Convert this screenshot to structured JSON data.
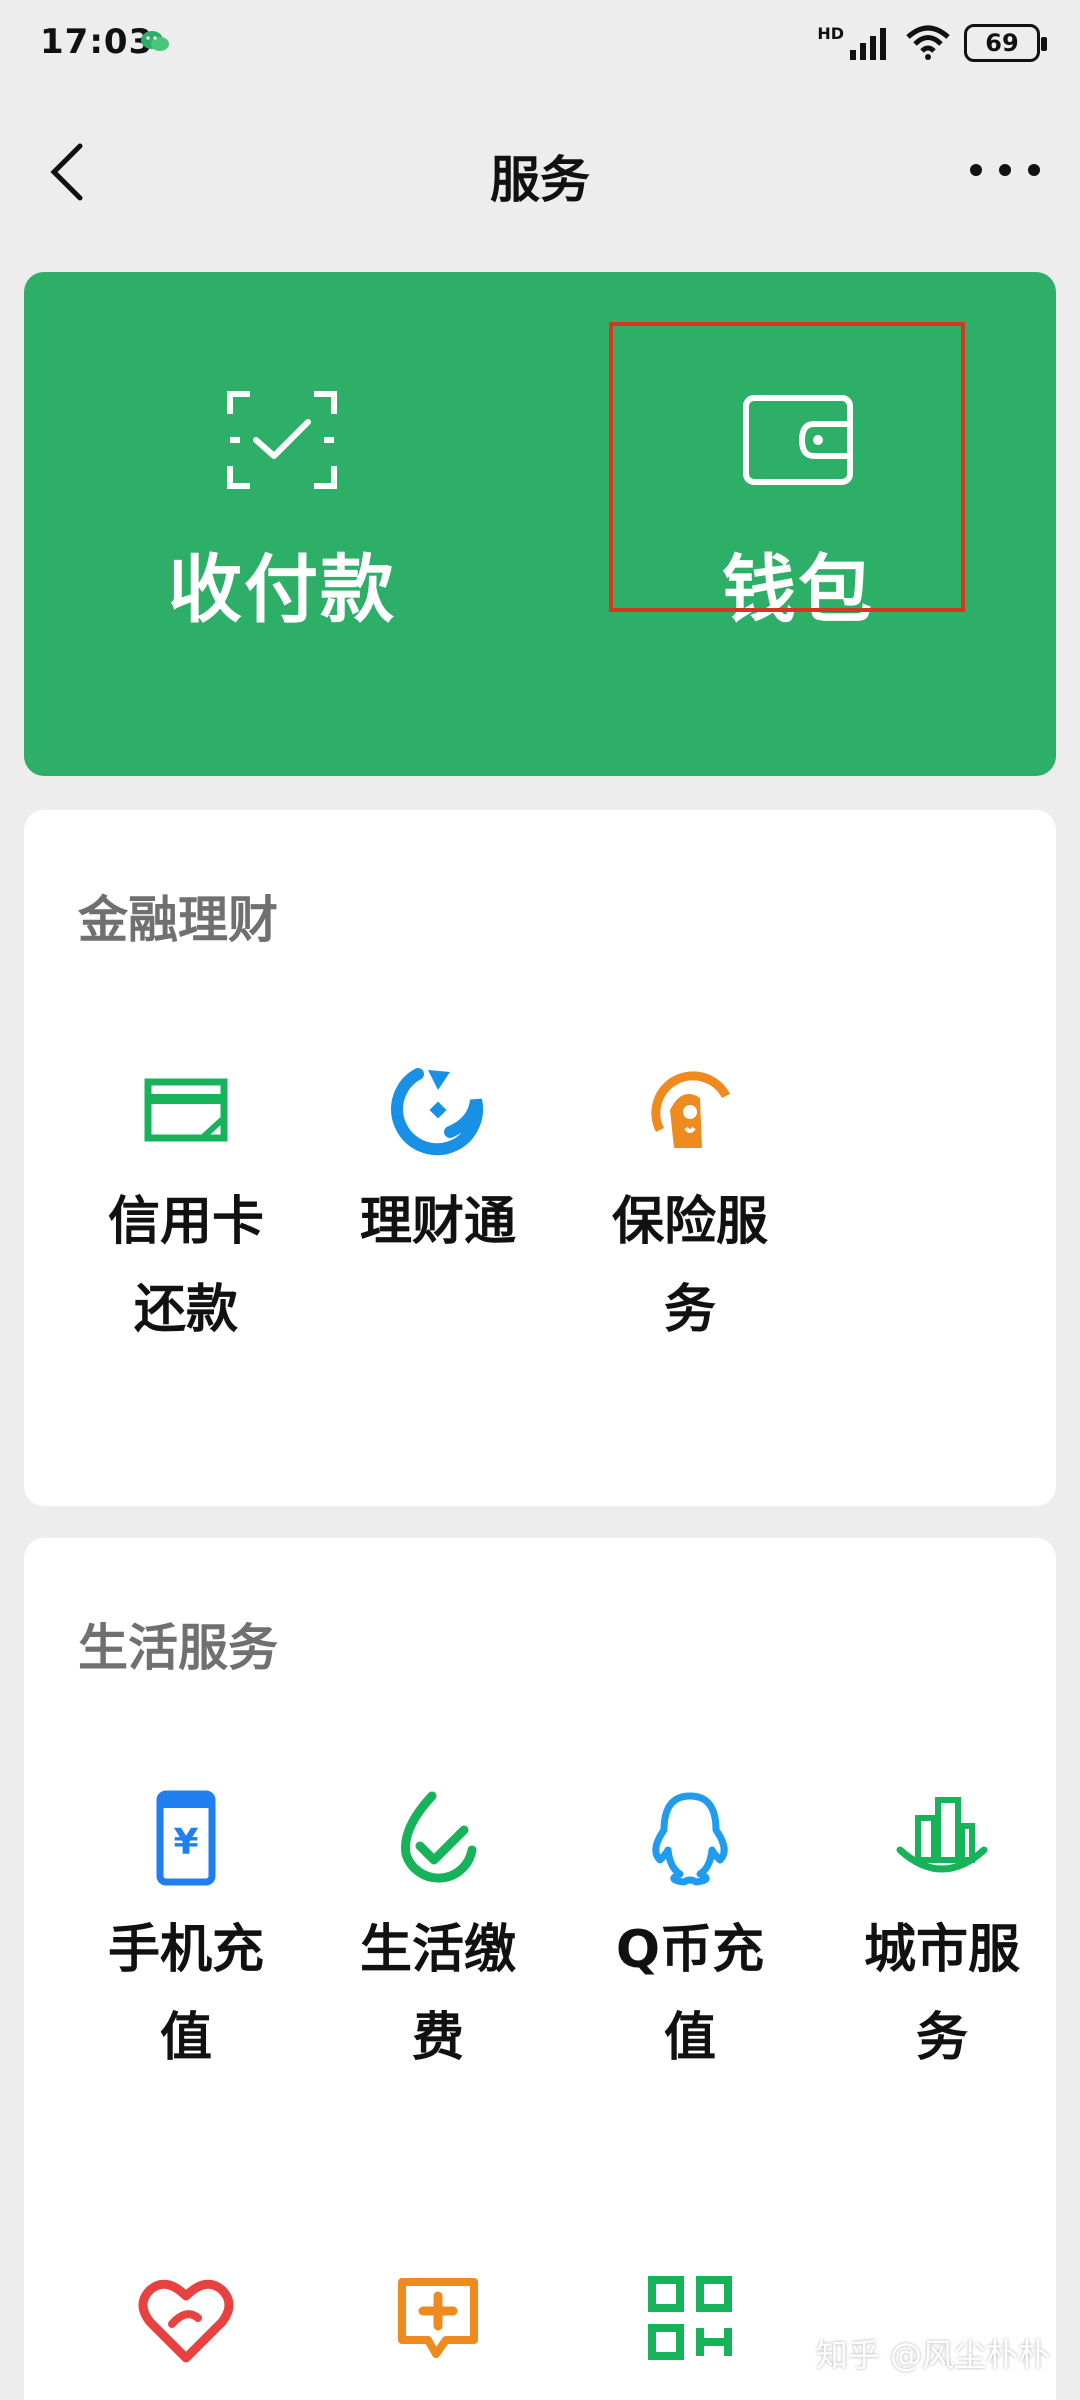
{
  "status_bar": {
    "time": "17:03",
    "network_label": "HD",
    "battery": "69"
  },
  "nav": {
    "title": "服务"
  },
  "top_card": {
    "background_color": "#2eaf68",
    "items": [
      {
        "label": "收付款",
        "icon": "scan-pay-icon"
      },
      {
        "label": "钱包",
        "icon": "wallet-icon"
      }
    ],
    "highlight_color": "#d9341f"
  },
  "finance": {
    "title": "金融理财",
    "items": [
      {
        "label": "信用卡还款",
        "icon": "credit-card-icon",
        "color": "#17b35a"
      },
      {
        "label": "理财通",
        "icon": "wealth-icon",
        "color": "#1890e6"
      },
      {
        "label": "保险服务",
        "icon": "insurance-icon",
        "color": "#ef8a1f"
      }
    ]
  },
  "life": {
    "title": "生活服务",
    "items": [
      {
        "label": "手机充值",
        "icon": "phone-topup-icon",
        "color": "#1f7ff0"
      },
      {
        "label": "生活缴费",
        "icon": "utility-payment-icon",
        "color": "#17b35a"
      },
      {
        "label": "Q币充值",
        "icon": "qq-icon",
        "color": "#1f9cf0"
      },
      {
        "label": "城市服务",
        "icon": "city-service-icon",
        "color": "#17b35a"
      },
      {
        "label": "",
        "icon": "charity-heart-icon",
        "color": "#e8413f"
      },
      {
        "label": "",
        "icon": "medical-chat-icon",
        "color": "#ef8a1f"
      },
      {
        "label": "",
        "icon": "qr-grid-icon",
        "color": "#17b35a"
      }
    ]
  },
  "watermark": "知乎 @风尘朴朴"
}
